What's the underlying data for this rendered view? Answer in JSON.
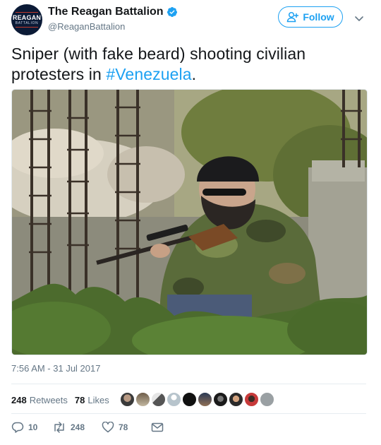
{
  "author": {
    "display_name": "The Reagan Battalion",
    "handle": "@ReaganBattalion",
    "avatar_text_line1": "REAGAN",
    "avatar_text_line2": "BATTALION",
    "verified": true
  },
  "follow_button": {
    "label": "Follow",
    "color": "#1da1f2"
  },
  "menu": {
    "icon": "chevron-down-icon"
  },
  "tweet": {
    "text": "Sniper (with fake beard) shooting civilian protesters in ",
    "hashtag": "#Venezuela",
    "text_end": ".",
    "timestamp": "7:56 AM - 31 Jul 2017"
  },
  "media": {
    "subject": "masked man with fake beard aiming rifle behind concrete wall and rebar"
  },
  "stats": {
    "retweets_count": "248",
    "retweets_label": "Retweets",
    "likes_count": "78",
    "likes_label": "Likes",
    "liker_avatars": 10
  },
  "actions": {
    "reply_count": "10",
    "retweet_count": "248",
    "like_count": "78"
  },
  "colors": {
    "accent": "#1da1f2",
    "text": "#14171a",
    "secondary": "#657786",
    "divider": "#e6ecf0",
    "retweet_icon": "#657786"
  }
}
